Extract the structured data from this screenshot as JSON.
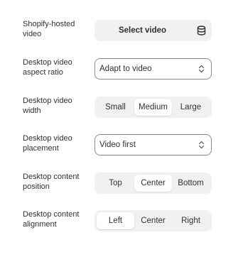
{
  "settings": {
    "shopify_video": {
      "label": "Shopify-hosted video",
      "button": "Select video",
      "icon": "database-icon"
    },
    "aspect_ratio": {
      "label": "Desktop video aspect ratio",
      "value": "Adapt to video",
      "icon": "chevron-up-down-icon"
    },
    "video_width": {
      "label": "Desktop video width",
      "options": [
        "Small",
        "Medium",
        "Large"
      ],
      "selected": "Medium"
    },
    "video_placement": {
      "label": "Desktop video placement",
      "value": "Video first",
      "icon": "chevron-up-down-icon"
    },
    "content_position": {
      "label": "Desktop content position",
      "options": [
        "Top",
        "Center",
        "Bottom"
      ],
      "selected": "Center"
    },
    "content_alignment": {
      "label": "Desktop content alignment",
      "options": [
        "Left",
        "Center",
        "Right"
      ],
      "selected": "Left"
    }
  },
  "colors": {
    "text": "#303030",
    "control_bg": "#f1f1f1",
    "select_border": "#8a8a8a",
    "active_segment": "#ffffff"
  }
}
